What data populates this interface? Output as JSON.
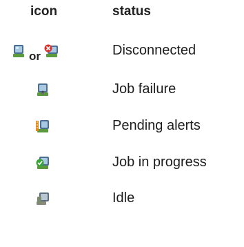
{
  "header": {
    "icon_col": "icon",
    "status_col": "status"
  },
  "rows": [
    {
      "status": "Disconnected",
      "icons": [
        "disconnected-icon",
        "disconnected-error-icon"
      ],
      "connector": "or"
    },
    {
      "status": "Job failure",
      "icons": [
        "job-failure-icon"
      ]
    },
    {
      "status": "Pending alerts",
      "icons": [
        "pending-alerts-icon"
      ]
    },
    {
      "status": "Job in progress",
      "icons": [
        "job-in-progress-icon"
      ]
    },
    {
      "status": "Idle",
      "icons": [
        "idle-icon"
      ]
    }
  ],
  "colors": {
    "monitor": "#7ea6c8",
    "monitor_dark": "#4a6f92",
    "base_green": "#5a9a3a",
    "error_red": "#d8322b",
    "alert_orange": "#e08a1e",
    "check_green": "#3aa33a"
  }
}
